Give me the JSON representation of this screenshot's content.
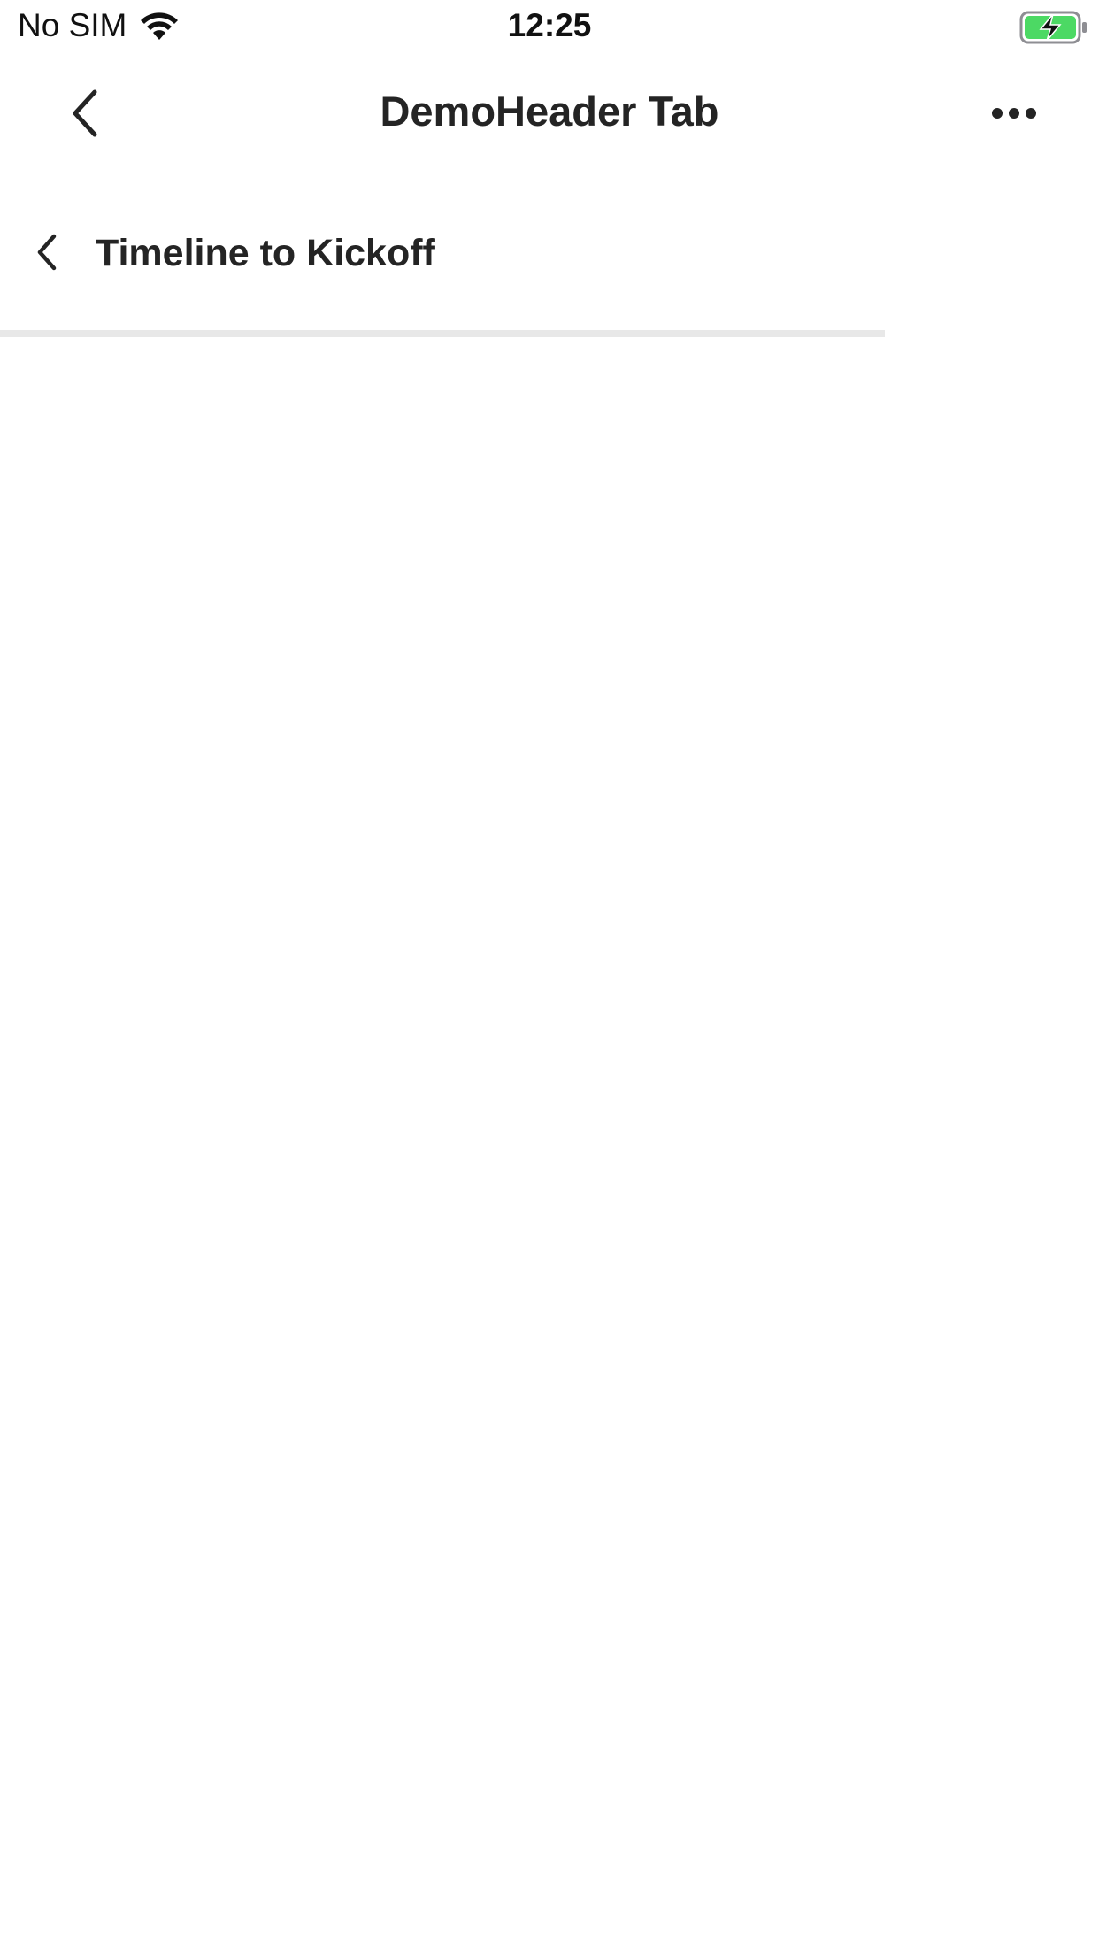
{
  "status_bar": {
    "carrier": "No SIM",
    "time": "12:25",
    "battery_color": "#4cd964"
  },
  "header": {
    "title": "DemoHeader Tab",
    "back_icon": "chevron-left-icon",
    "more_icon": "more-horizontal-icon"
  },
  "sub_header": {
    "title": "Timeline to Kickoff",
    "back_icon": "chevron-left-icon"
  }
}
